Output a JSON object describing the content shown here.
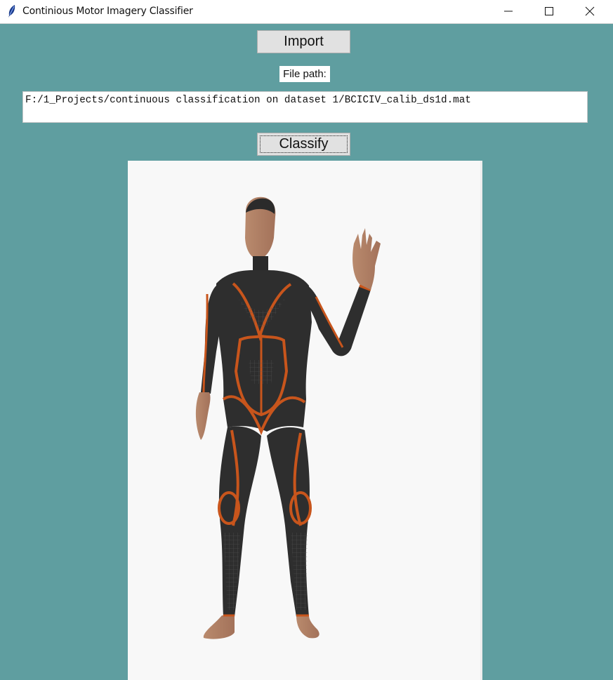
{
  "window": {
    "title": "Continious Motor Imagery Classifier",
    "app_icon": "feather-icon"
  },
  "controls": {
    "import_label": "Import",
    "file_path_label": "File path:",
    "file_path_value": "F:/1_Projects/continuous classification on dataset 1/BCICIV_calib_ds1d.mat",
    "classify_label": "Classify"
  },
  "image": {
    "subject": "3D avatar in dark bodysuit with orange lines waving right hand"
  },
  "colors": {
    "background": "#5f9ea0",
    "button": "#e1e1e1",
    "accent_suit_lines": "#c8551c"
  }
}
